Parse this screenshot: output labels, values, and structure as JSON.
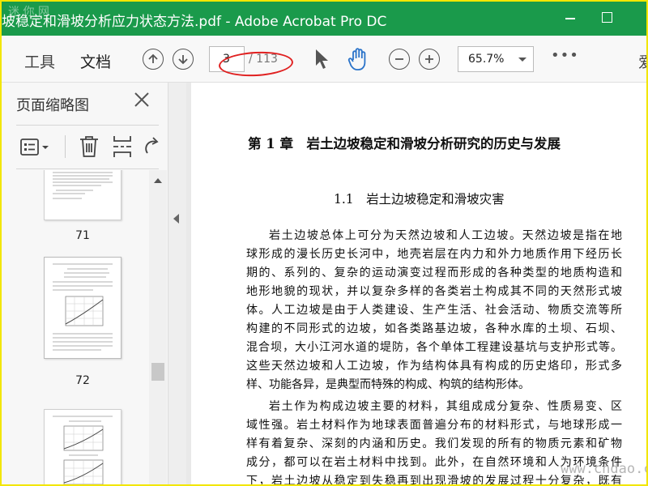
{
  "window": {
    "title": "坡稳定和滑坡分析应力状态方法.pdf - Adobe Acrobat Pro DC",
    "watermark_corner": "迷 你 网"
  },
  "toolbar": {
    "tab_tools": "工具",
    "tab_document": "文档",
    "current_page": "3",
    "total_pages": "/ 113",
    "zoom": "65.7%",
    "more": "•••",
    "share_cut": "爱"
  },
  "thumbnails_panel": {
    "title": "页面缩略图",
    "pages": [
      {
        "label": "71"
      },
      {
        "label": "72"
      },
      {
        "label": ""
      }
    ]
  },
  "document": {
    "chapter_title": "第 1 章　岩土边坡稳定和滑坡分析研究的历史与发展",
    "section_title": "1.1　岩土边坡稳定和滑坡灾害",
    "paragraph1": [
      "岩土边坡总体上可分为天然边坡和人工边坡。天然边坡是指在地",
      "球形成的漫长历史长河中，地壳岩层在内力和外力地质作用下经历长",
      "期的、系列的、复杂的运动演变过程而形成的各种类型的地质构造和",
      "地形地貌的现状，并以复杂多样的各类岩土构成其不同的天然形式坡",
      "体。人工边坡是由于人类建设、生产生活、社会活动、物质交流等所",
      "构建的不同形式的边坡，如各类路基边坡，各种水库的土坝、石坝、",
      "混合坝，大小江河水道的堤防，各个单体工程建设基坑与支护形式等。",
      "这些天然边坡和人工边坡，作为结构体具有构成的历史烙印，形式多",
      "样、功能各异，是典型而特殊的构成、构筑的结构形体。"
    ],
    "paragraph2": [
      "岩土作为构成边坡主要的材料，其组成成分复杂、性质易变、区",
      "域性强。岩土材料作为地球表面普遍分布的材料形式，与地球形成一",
      "样有着复杂、深刻的内涵和历史。我们发现的所有的物质元素和矿物",
      "成分，都可以在岩土材料中找到。此外，在自然环境和人为环境条件",
      "下，岩土边坡从稳定到失稳再到出现滑坡的发展过程十分复杂，既有"
    ]
  },
  "site_watermark": "www.cndao.com",
  "colors": {
    "titlebar": "#1a9a4b",
    "annotation_oval": "#e02020",
    "border": "#f2e600"
  }
}
